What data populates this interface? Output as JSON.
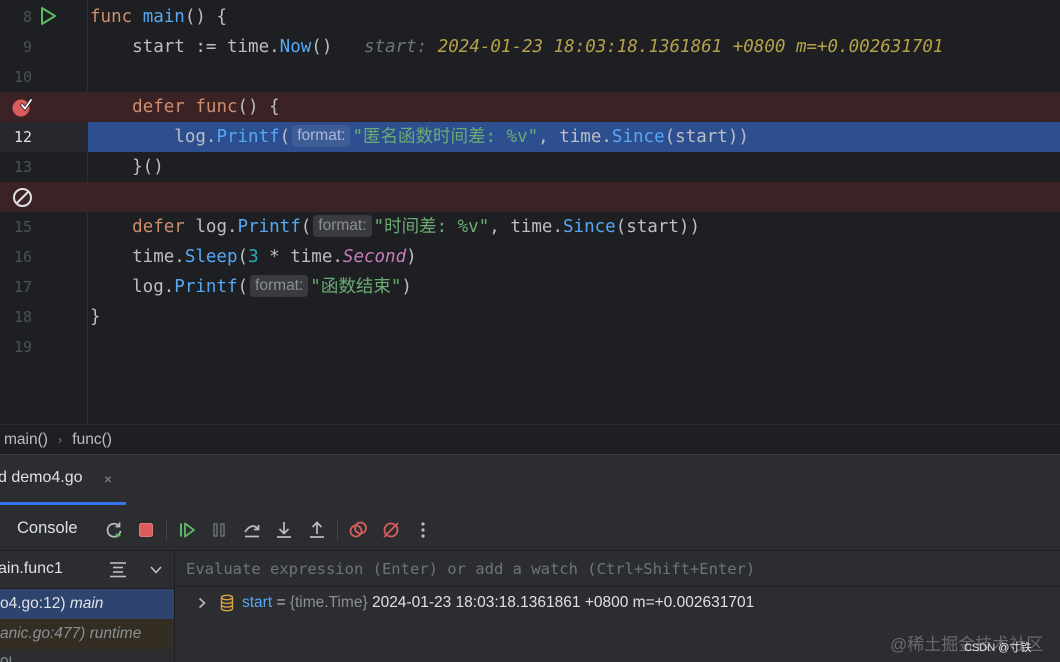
{
  "editor": {
    "lines": [
      {
        "n": "8",
        "tokens": [
          [
            "kw",
            "func "
          ],
          [
            "fn",
            "main"
          ],
          [
            "p",
            "() {"
          ]
        ]
      },
      {
        "n": "9",
        "tokens": [
          [
            "p",
            "    start := "
          ],
          [
            "pkg",
            "time"
          ],
          [
            "p",
            "."
          ],
          [
            "fn",
            "Now"
          ],
          [
            "p",
            "()   "
          ],
          [
            "inl-label",
            "start: "
          ],
          [
            "inl-val",
            "2024-01-23 18:03:18.1361861 +0800 m=+0.002631701"
          ]
        ]
      },
      {
        "n": "10",
        "tokens": []
      },
      {
        "n": "",
        "tokens": [
          [
            "p",
            "    "
          ],
          [
            "kw",
            "defer func"
          ],
          [
            "p",
            "() {"
          ]
        ]
      },
      {
        "n": "12",
        "tokens": [
          [
            "p",
            "        log."
          ],
          [
            "fn",
            "Printf"
          ],
          [
            "p",
            "("
          ],
          [
            "hint",
            "format:"
          ],
          [
            "str",
            "\"匿名函数时间差: %v\""
          ],
          [
            "p",
            ", time."
          ],
          [
            "fn",
            "Since"
          ],
          [
            "p",
            "(start))"
          ]
        ]
      },
      {
        "n": "13",
        "tokens": [
          [
            "p",
            "    }()"
          ]
        ]
      },
      {
        "n": "",
        "tokens": []
      },
      {
        "n": "15",
        "tokens": [
          [
            "p",
            "    "
          ],
          [
            "kw",
            "defer "
          ],
          [
            "p",
            "log."
          ],
          [
            "fn",
            "Printf"
          ],
          [
            "p",
            "("
          ],
          [
            "hint",
            "format:"
          ],
          [
            "str",
            "\"时间差: %v\""
          ],
          [
            "p",
            ", time."
          ],
          [
            "fn",
            "Since"
          ],
          [
            "p",
            "(start))"
          ]
        ]
      },
      {
        "n": "16",
        "tokens": [
          [
            "p",
            "    time."
          ],
          [
            "fn",
            "Sleep"
          ],
          [
            "p",
            "("
          ],
          [
            "num",
            "3"
          ],
          [
            "p",
            " * time."
          ],
          [
            "const-it",
            "Second"
          ],
          [
            "p",
            ")"
          ]
        ]
      },
      {
        "n": "17",
        "tokens": [
          [
            "p",
            "    log."
          ],
          [
            "fn",
            "Printf"
          ],
          [
            "p",
            "("
          ],
          [
            "hint",
            "format:"
          ],
          [
            "str",
            "\"函数结束\""
          ],
          [
            "p",
            ")"
          ]
        ]
      },
      {
        "n": "18",
        "tokens": [
          [
            "p",
            "}"
          ]
        ]
      },
      {
        "n": "19",
        "tokens": []
      }
    ]
  },
  "breadcrumb": {
    "items": [
      "main()",
      "func()"
    ],
    "separator": "›"
  },
  "debug": {
    "tab_label": "d demo4.go",
    "tab_close": "×",
    "console_label": "Console",
    "thread": "ain.func1",
    "frames": [
      {
        "loc": "o4.go:12)",
        "fn": "main",
        "selected": true
      },
      {
        "loc": "anic.go:477)",
        "fn": "runtime",
        "selected": false
      },
      {
        "loc": "0l",
        "fn": "",
        "selected": false
      }
    ],
    "eval_placeholder": "Evaluate expression (Enter) or add a watch (Ctrl+Shift+Enter)",
    "variable": {
      "name": "start",
      "eq": " = ",
      "type": "{time.Time}",
      "value": " 2024-01-23 18:03:18.1361861 +0800 m=+0.002631701"
    }
  },
  "watermark": {
    "text": "@稀土掘金技术社区",
    "csdn": "CSDN @寸铁"
  },
  "colors": {
    "accent": "#3574f0",
    "breakpoint": "#db5c5c",
    "current_line": "#2e4f8f",
    "breakpoint_line": "#3b2325",
    "run": "#5fb865"
  }
}
